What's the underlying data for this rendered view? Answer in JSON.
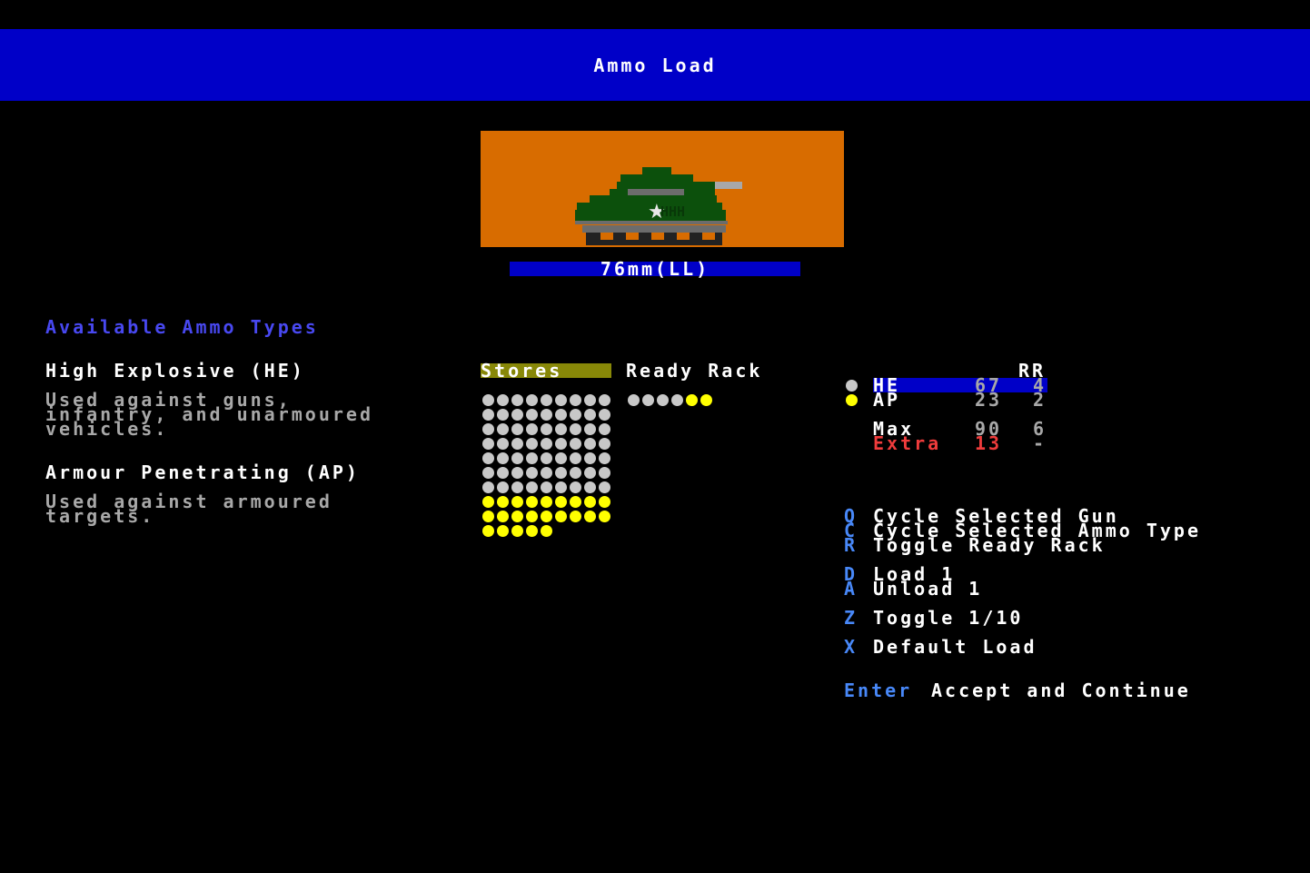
{
  "header": {
    "title": "Ammo Load"
  },
  "gun": {
    "name": "76mm(LL)"
  },
  "colors": {
    "header_bg": "#0000c8",
    "tank_bg": "#d86c00",
    "stores_highlight": "#888808",
    "he_dot": "#c8c8c8",
    "ap_dot": "#ffff00",
    "key": "#4888f8",
    "extra": "#f03c3c"
  },
  "info": {
    "heading": "Available Ammo Types",
    "he": {
      "name": "High Explosive (HE)",
      "desc": [
        "Used against guns,",
        "infantry, and unarmoured",
        "vehicles."
      ]
    },
    "ap": {
      "name": "Armour Penetrating (AP)",
      "desc": [
        "Used against armoured",
        "targets."
      ]
    }
  },
  "storage": {
    "stores_label": "Stores",
    "ready_rack_label": "Ready Rack",
    "stores": {
      "he": 63,
      "ap": 23
    },
    "ready_rack": {
      "he": 4,
      "ap": 2
    }
  },
  "table": {
    "rr_header": "RR",
    "rows": [
      {
        "label": "HE",
        "stores": "67",
        "rr": "4",
        "selected": true
      },
      {
        "label": "AP",
        "stores": "23",
        "rr": "2",
        "selected": false
      }
    ],
    "max": {
      "label": "Max",
      "stores": "90",
      "rr": "6"
    },
    "extra": {
      "label": "Extra",
      "stores": "13",
      "rr": "-"
    }
  },
  "controls": [
    {
      "key": "Q",
      "label": "Cycle Selected Gun"
    },
    {
      "key": "C",
      "label": "Cycle Selected Ammo Type"
    },
    {
      "key": "R",
      "label": "Toggle Ready Rack"
    },
    {
      "key": "D",
      "label": "Load 1"
    },
    {
      "key": "A",
      "label": "Unload 1"
    },
    {
      "key": "Z",
      "label": "Toggle 1/10"
    },
    {
      "key": "X",
      "label": "Default Load"
    },
    {
      "key": "Enter",
      "label": "Accept and Continue"
    }
  ]
}
